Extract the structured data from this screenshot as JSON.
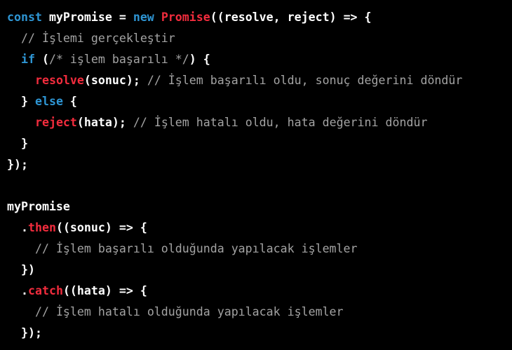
{
  "code": {
    "lines": [
      [
        {
          "t": "const",
          "c": "keyword"
        },
        {
          "t": " myPromise = ",
          "c": "plain"
        },
        {
          "t": "new",
          "c": "keyword"
        },
        {
          "t": " ",
          "c": "plain"
        },
        {
          "t": "Promise",
          "c": "class"
        },
        {
          "t": "((resolve, reject) => {",
          "c": "plain"
        }
      ],
      [
        {
          "t": "  ",
          "c": "plain"
        },
        {
          "t": "// İşlemi gerçekleştir",
          "c": "comment"
        }
      ],
      [
        {
          "t": "  ",
          "c": "plain"
        },
        {
          "t": "if",
          "c": "keyword"
        },
        {
          "t": " (",
          "c": "plain"
        },
        {
          "t": "/* işlem başarılı */",
          "c": "comment"
        },
        {
          "t": ") {",
          "c": "plain"
        }
      ],
      [
        {
          "t": "    ",
          "c": "plain"
        },
        {
          "t": "resolve",
          "c": "fn"
        },
        {
          "t": "(sonuc); ",
          "c": "plain"
        },
        {
          "t": "// İşlem başarılı oldu, sonuç değerini döndür",
          "c": "comment"
        }
      ],
      [
        {
          "t": "  } ",
          "c": "plain"
        },
        {
          "t": "else",
          "c": "keyword"
        },
        {
          "t": " {",
          "c": "plain"
        }
      ],
      [
        {
          "t": "    ",
          "c": "plain"
        },
        {
          "t": "reject",
          "c": "fn"
        },
        {
          "t": "(hata); ",
          "c": "plain"
        },
        {
          "t": "// İşlem hatalı oldu, hata değerini döndür",
          "c": "comment"
        }
      ],
      [
        {
          "t": "  }",
          "c": "plain"
        }
      ],
      [
        {
          "t": "});",
          "c": "plain"
        }
      ],
      [],
      [
        {
          "t": "myPromise",
          "c": "plain"
        }
      ],
      [
        {
          "t": "  .",
          "c": "plain"
        },
        {
          "t": "then",
          "c": "fn"
        },
        {
          "t": "((sonuc) => {",
          "c": "plain"
        }
      ],
      [
        {
          "t": "    ",
          "c": "plain"
        },
        {
          "t": "// İşlem başarılı olduğunda yapılacak işlemler",
          "c": "comment"
        }
      ],
      [
        {
          "t": "  })",
          "c": "plain"
        }
      ],
      [
        {
          "t": "  .",
          "c": "plain"
        },
        {
          "t": "catch",
          "c": "fn"
        },
        {
          "t": "((hata) => {",
          "c": "plain"
        }
      ],
      [
        {
          "t": "    ",
          "c": "plain"
        },
        {
          "t": "// İşlem hatalı olduğunda yapılacak işlemler",
          "c": "comment"
        }
      ],
      [
        {
          "t": "  });",
          "c": "plain"
        }
      ]
    ]
  },
  "colors": {
    "background": "#000000",
    "keyword": "#2e95d3",
    "function": "#f22c3d",
    "comment": "#a3a3a3",
    "plain": "#ffffff"
  }
}
